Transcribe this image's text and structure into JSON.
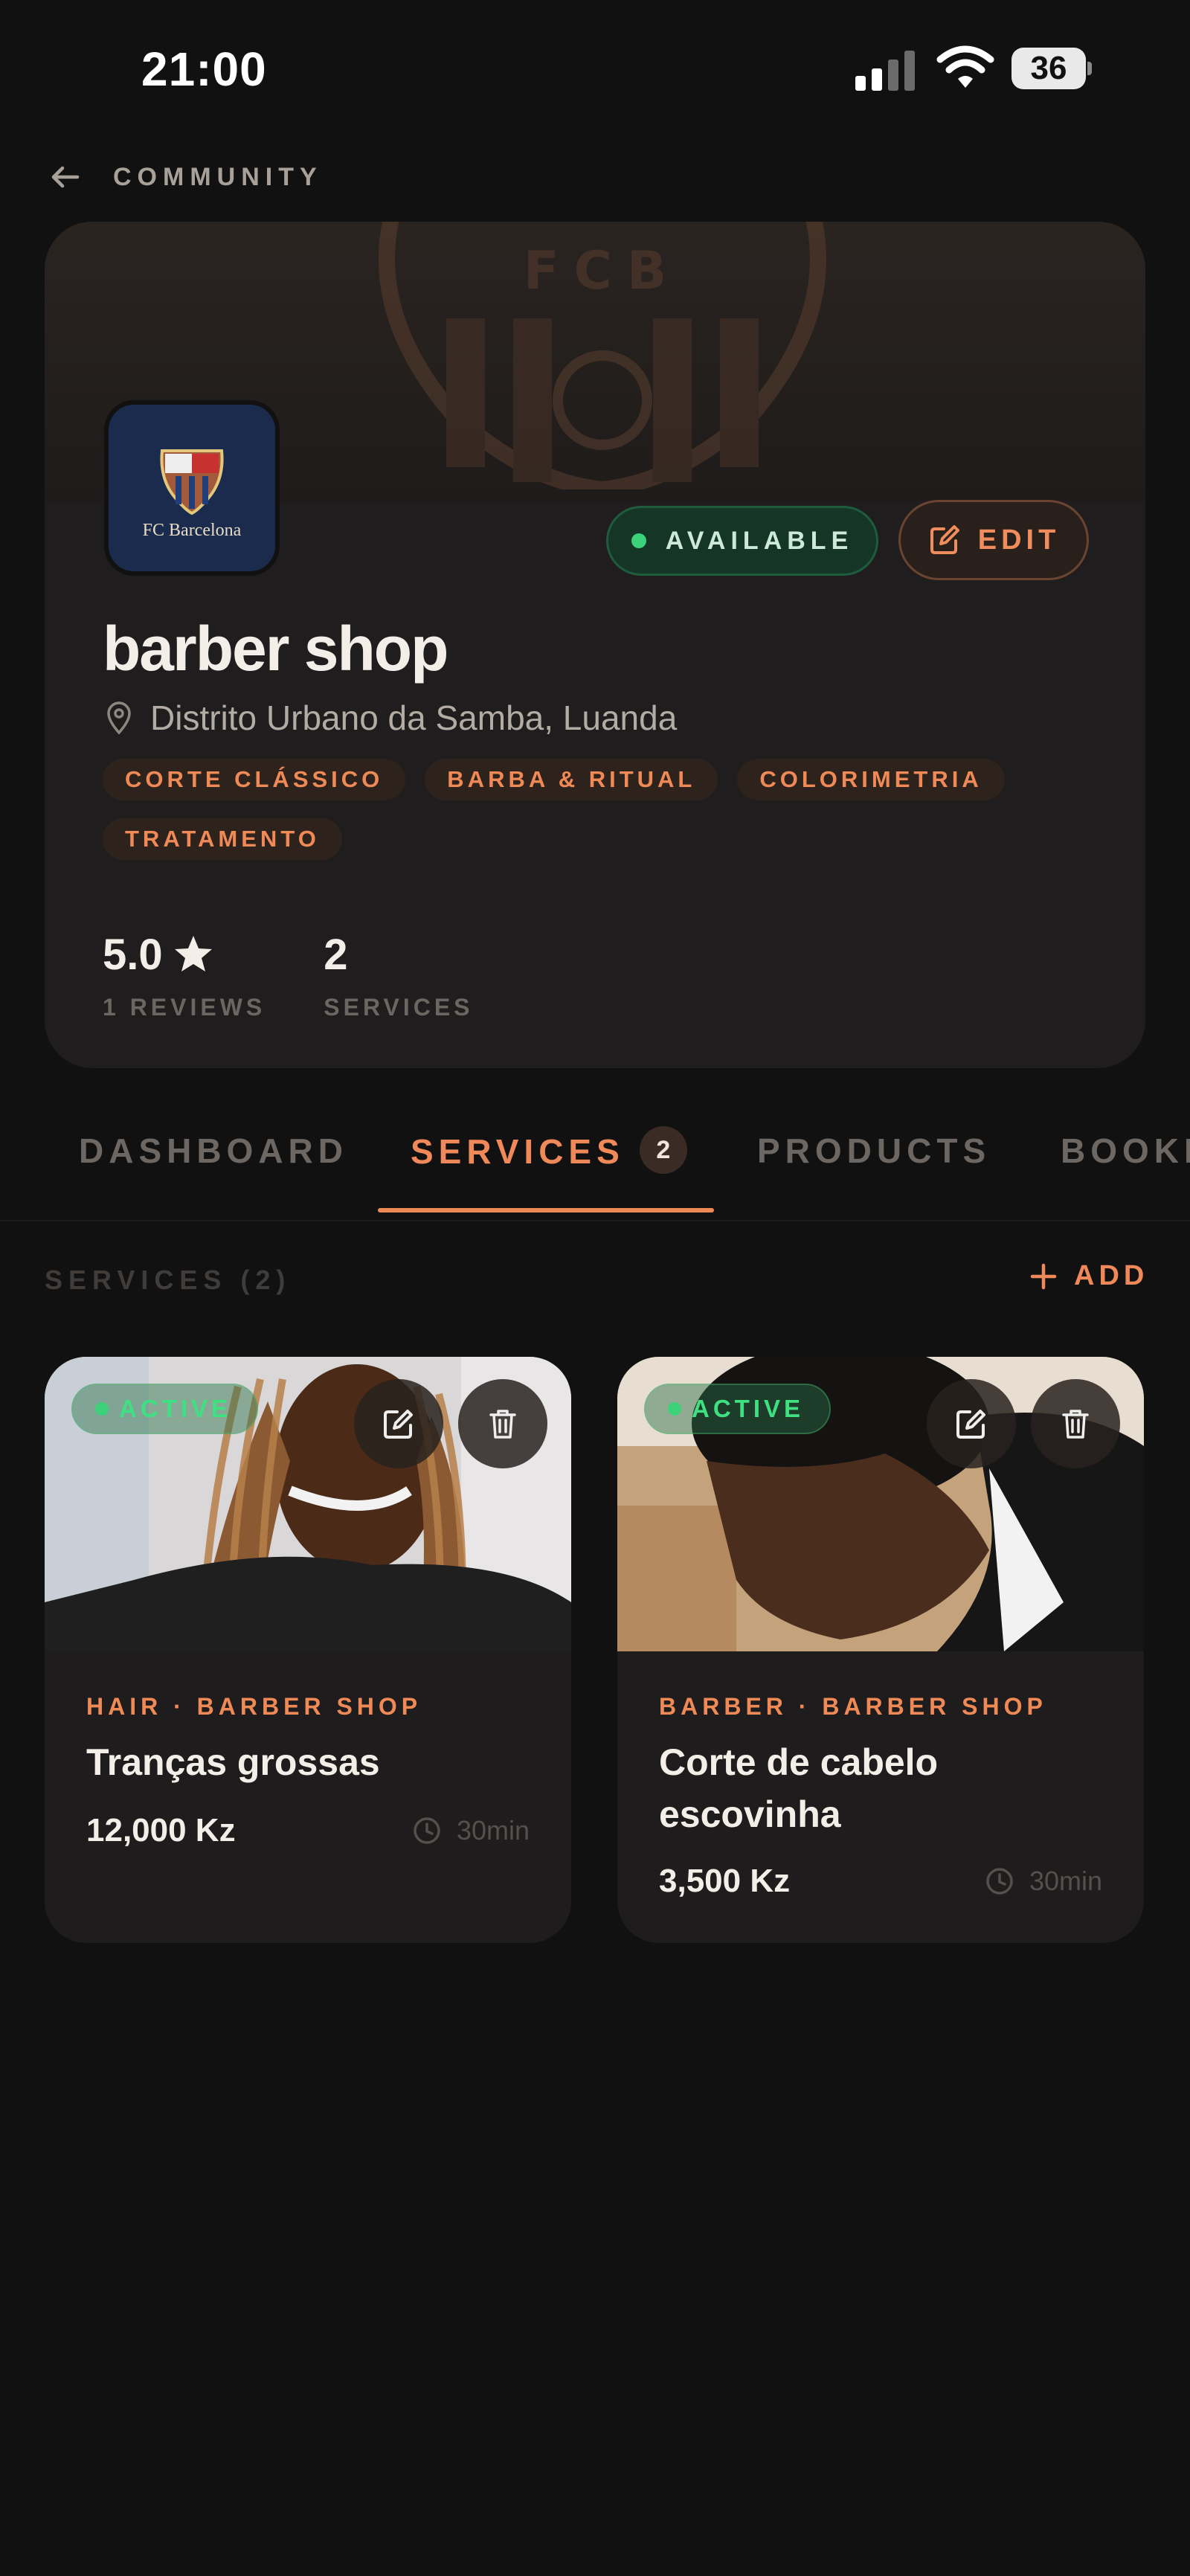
{
  "status_bar": {
    "time": "21:00",
    "battery": "36"
  },
  "nav": {
    "back_label": "COMMUNITY"
  },
  "profile": {
    "avatar_text": "FC Barcelona",
    "banner_text": "FCB",
    "status": "AVAILABLE",
    "edit_label": "EDIT",
    "name": "barber shop",
    "location": "Distrito Urbano da Samba, Luanda",
    "tags": [
      "CORTE CLÁSSICO",
      "BARBA & RITUAL",
      "COLORIMETRIA",
      "TRATAMENTO"
    ],
    "stats": {
      "rating_value": "5.0",
      "rating_label": "1 REVIEWS",
      "services_value": "2",
      "services_label": "SERVICES"
    }
  },
  "tabs": [
    {
      "label": "DASHBOARD"
    },
    {
      "label": "SERVICES",
      "badge": "2",
      "active": true
    },
    {
      "label": "PRODUCTS"
    },
    {
      "label": "BOOKI"
    }
  ],
  "section": {
    "title": "SERVICES (2)",
    "add_label": "ADD"
  },
  "services": [
    {
      "status": "ACTIVE",
      "category": "HAIR · BARBER SHOP",
      "title": "Tranças grossas",
      "price": "12,000 Kz",
      "duration": "30min"
    },
    {
      "status": "ACTIVE",
      "category": "BARBER · BARBER SHOP",
      "title": "Corte de cabelo escovinha",
      "price": "3,500 Kz",
      "duration": "30min"
    }
  ],
  "colors": {
    "accent": "#ef8a57",
    "success": "#3dd17a",
    "background": "#121111",
    "card": "#1f1d1d"
  },
  "icons": [
    "back-arrow-icon",
    "signal-icon",
    "wifi-icon",
    "battery-icon",
    "location-pin-icon",
    "edit-icon",
    "star-icon",
    "plus-icon",
    "trash-icon",
    "clock-icon"
  ]
}
